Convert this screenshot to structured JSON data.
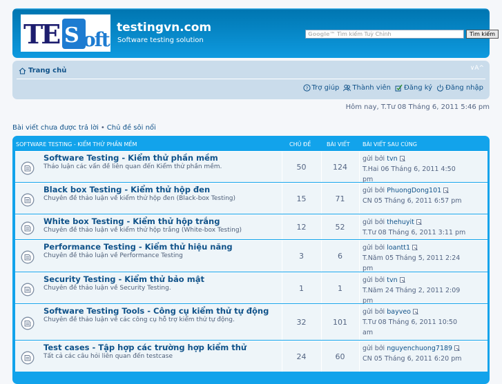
{
  "site": {
    "title": "testingvn.com",
    "description": "Software testing solution",
    "logo_text": "TeSoft"
  },
  "search": {
    "brand": "Google",
    "placeholder": "Tìm kiếm Tuỳ Chỉnh",
    "button_label": "Tìm kiếm"
  },
  "nav": {
    "home_label": "Trang chủ",
    "font_resize": "∨A^",
    "links": [
      {
        "label": "Trợ giúp",
        "icon": "help-icon"
      },
      {
        "label": "Thành viên",
        "icon": "members-icon"
      },
      {
        "label": "Đăng ký",
        "icon": "register-icon"
      },
      {
        "label": "Đăng nhập",
        "icon": "login-icon"
      }
    ]
  },
  "date_line": "Hôm nay, T.Tư 08 Tháng 6, 2011 5:46 pm",
  "quick_links": {
    "unanswered": "Bài viết chưa được trả lời",
    "separator": "•",
    "active": "Chủ đề sôi nổi"
  },
  "forum": {
    "category": "Software Testing - Kiểm thử phần mềm",
    "col_topics": "Chủ đề",
    "col_posts": "Bài viết",
    "col_last": "Bài viết sau cùng",
    "rows": [
      {
        "title": "Software Testing - Kiểm thử phần mềm",
        "desc": "Thảo luận các vấn đề liên quan đến Kiểm thử phần mềm.",
        "topics": "50",
        "posts": "124",
        "by": "gửi bởi",
        "user": "tvn",
        "date1": "T.Hai 06 Tháng 6, 2011 4:50",
        "date2": "pm"
      },
      {
        "title": "Black box Testing - Kiểm thử hộp đen",
        "desc": "Chuyên đề thảo luận về kiểm thử hộp đen (Black-box Testing)",
        "topics": "15",
        "posts": "71",
        "by": "gửi bởi",
        "user": "PhuongDong101",
        "date1": "CN 05 Tháng 6, 2011 6:57 pm",
        "date2": ""
      },
      {
        "title": "White box Testing - Kiểm thử hộp trắng",
        "desc": "Chuyên đề thảo luận về kiểm thử hộp trắng (White-box Testing)",
        "topics": "12",
        "posts": "52",
        "by": "gửi bởi",
        "user": "thehuyit",
        "date1": "T.Tư 08 Tháng 6, 2011 3:11 pm",
        "date2": ""
      },
      {
        "title": "Performance Testing - Kiểm thử hiệu năng",
        "desc": "Chuyên đề thảo luận về Performance Testing",
        "topics": "3",
        "posts": "6",
        "by": "gửi bởi",
        "user": "loantt1",
        "date1": "T.Năm 05 Tháng 5, 2011 2:24",
        "date2": "pm"
      },
      {
        "title": "Security Testing - Kiểm thử bảo mật",
        "desc": "Chuyên đề thảo luận về Security Testing.",
        "topics": "1",
        "posts": "1",
        "by": "gửi bởi",
        "user": "tvn",
        "date1": "T.Năm 24 Tháng 2, 2011 2:09",
        "date2": "pm"
      },
      {
        "title": "Software Testing Tools - Công cụ kiểm thử tự động",
        "desc": "Chuyên đề thảo luận về các công cụ hỗ trợ kiểm thử tự động.",
        "topics": "32",
        "posts": "101",
        "by": "gửi bởi",
        "user": "bayveo",
        "date1": "T.Tư 08 Tháng 6, 2011 10:50",
        "date2": "am"
      },
      {
        "title": "Test cases - Tập hợp các trường hợp kiểm thử",
        "desc": "Tất cả các câu hỏi liên quan đến testcase",
        "topics": "24",
        "posts": "60",
        "by": "gửi bởi",
        "user": "nguyenchuong7189",
        "date1": "CN 05 Tháng 6, 2011 6:20 pm",
        "date2": ""
      }
    ]
  }
}
